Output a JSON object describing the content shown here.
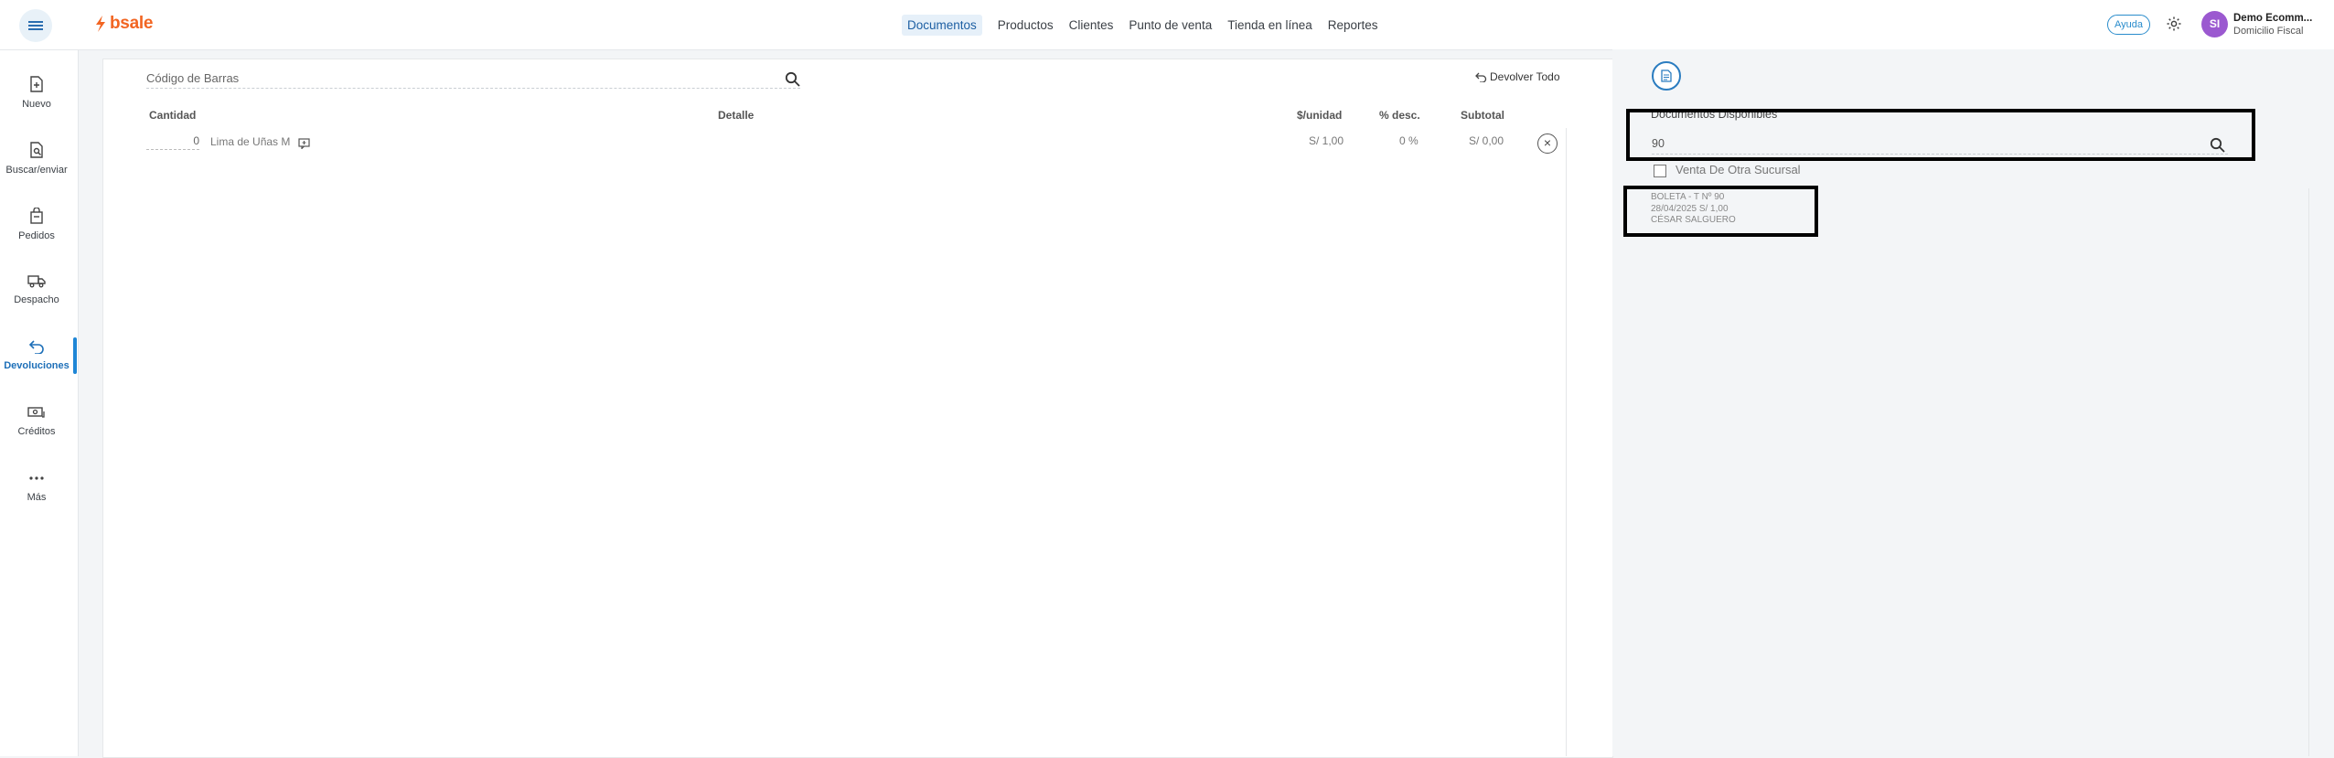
{
  "header": {
    "logo_text": "bsale",
    "nav": [
      {
        "label": "Documentos",
        "active": true
      },
      {
        "label": "Productos",
        "active": false
      },
      {
        "label": "Clientes",
        "active": false
      },
      {
        "label": "Punto de venta",
        "active": false
      },
      {
        "label": "Tienda en línea",
        "active": false
      },
      {
        "label": "Reportes",
        "active": false
      }
    ],
    "help_label": "Ayuda",
    "avatar_initials": "SI",
    "user_name": "Demo Ecomm...",
    "user_sub": "Domicilio Fiscal"
  },
  "sidebar": {
    "items": [
      {
        "label": "Nuevo",
        "icon": "file-plus-icon"
      },
      {
        "label": "Buscar/enviar",
        "icon": "file-search-icon"
      },
      {
        "label": "Pedidos",
        "icon": "bag-icon"
      },
      {
        "label": "Despacho",
        "icon": "truck-icon"
      },
      {
        "label": "Devoluciones",
        "icon": "return-icon",
        "active": true
      },
      {
        "label": "Créditos",
        "icon": "money-icon"
      },
      {
        "label": "Más",
        "icon": "more-icon"
      }
    ]
  },
  "main": {
    "barcode_placeholder": "Código de Barras",
    "return_all_label": "Devolver Todo",
    "columns": {
      "quantity": "Cantidad",
      "detail": "Detalle",
      "unit_price": "$/unidad",
      "discount": "% desc.",
      "subtotal": "Subtotal"
    },
    "rows": [
      {
        "quantity": "0",
        "detail": "Lima de Uñas M",
        "unit_price": "S/ 1,00",
        "discount": "0 %",
        "subtotal": "S/ 0,00"
      }
    ]
  },
  "right": {
    "docs_label": "Documentos Disponibles",
    "search_value": "90",
    "branch_checkbox_label": "Venta De Otra Sucursal",
    "branch_checked": false,
    "result": {
      "line1": "BOLETA - T Nº 90",
      "line2": "28/04/2025 S/ 1,00",
      "line3": "CÉSAR SALGUERO"
    }
  },
  "colors": {
    "brand": "#f26522",
    "accent": "#1f86d6",
    "avatar": "#9b59d0"
  }
}
